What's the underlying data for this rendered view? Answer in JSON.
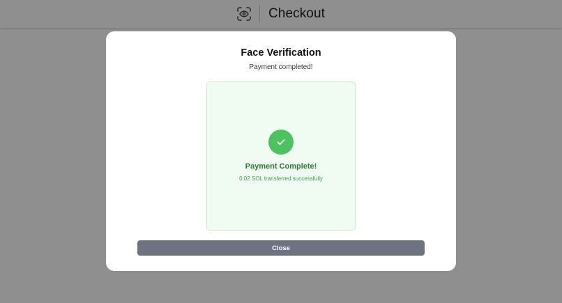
{
  "header": {
    "icon": "eye-scan-icon",
    "title": "Checkout"
  },
  "modal": {
    "title": "Face Verification",
    "subtitle": "Payment completed!",
    "status": {
      "icon": "check-icon",
      "title": "Payment Complete!",
      "detail": "0.02 SOL transferred successfully"
    },
    "close_label": "Close"
  },
  "colors": {
    "backdrop": "#8f8f8f",
    "success": "#4cc35f",
    "success_text": "#2f7d35",
    "panel_bg": "#f0fbf2",
    "button": "#6e7384"
  }
}
